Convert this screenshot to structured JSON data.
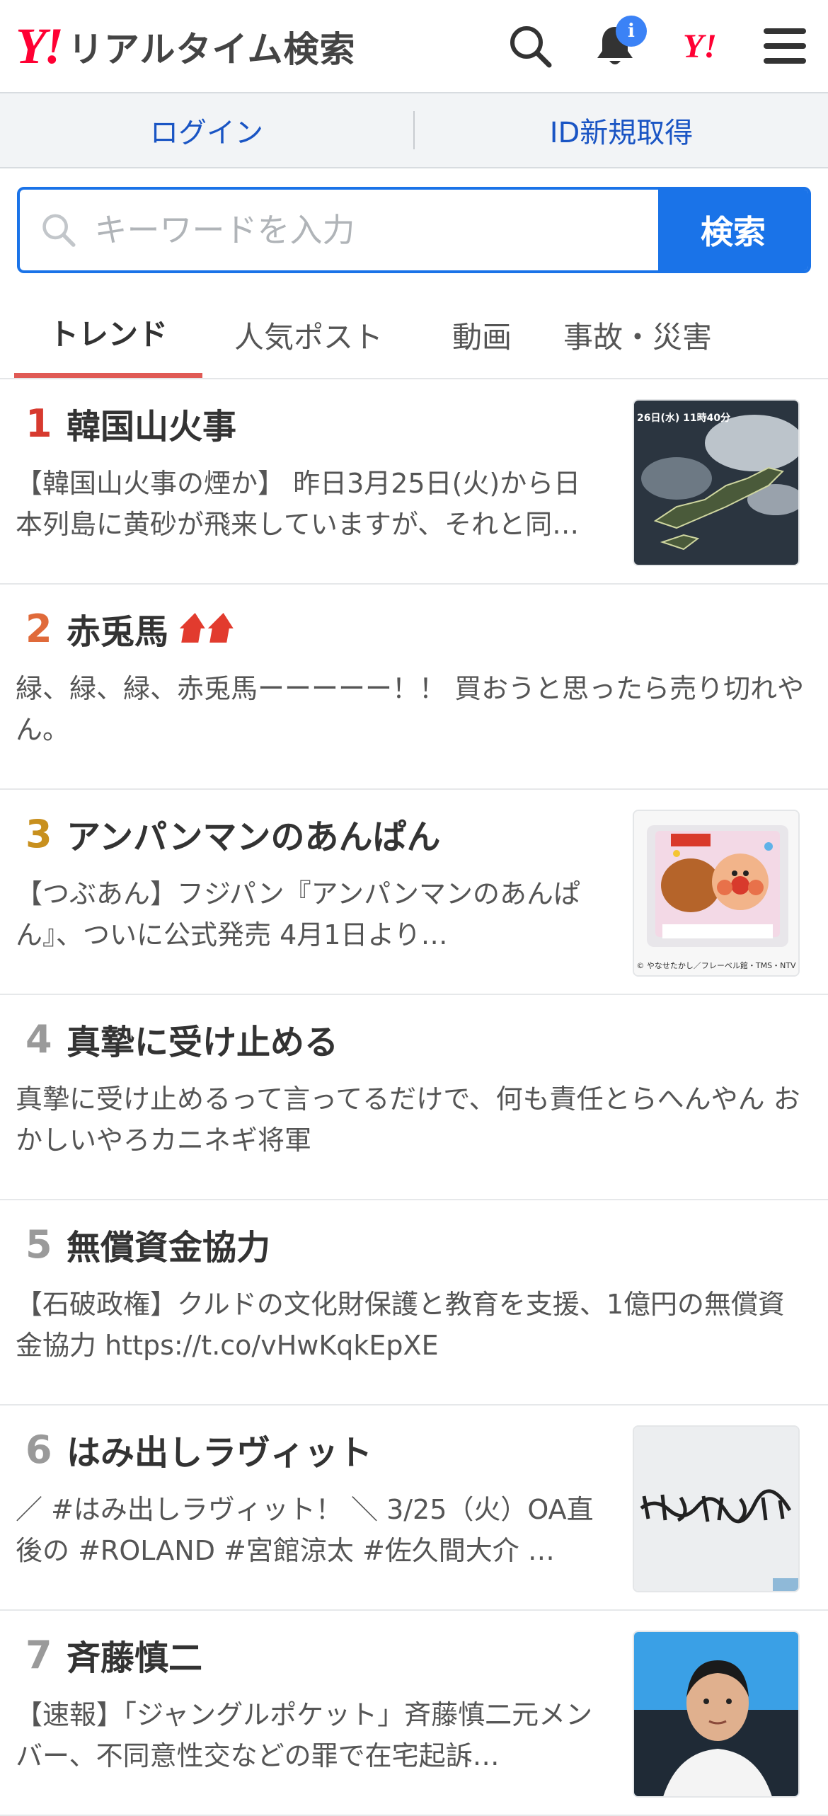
{
  "header": {
    "logo_mark": "Y!",
    "logo_text": "リアルタイム検索",
    "notification_badge": "i",
    "yahoo_small_logo": "Y!"
  },
  "account": {
    "login": "ログイン",
    "register": "ID新規取得"
  },
  "search": {
    "placeholder": "キーワードを入力",
    "button": "検索"
  },
  "tabs": [
    {
      "label": "トレンド",
      "active": true
    },
    {
      "label": "人気ポスト",
      "active": false
    },
    {
      "label": "動画",
      "active": false
    },
    {
      "label": "事故・災害",
      "active": false
    }
  ],
  "trends": [
    {
      "rank": "1",
      "rank_color": "#d73a2f",
      "title": "韓国山火事",
      "text": "【韓国山火事の煙か】 昨日3月25日(火)から日本列島に黄砂が飛来していますが、それと同…",
      "thumb_icon": "satellite-map-thumbnail",
      "thumb_caption": "26日(水) 11時40分"
    },
    {
      "rank": "2",
      "rank_color": "#e06a3a",
      "title": "赤兎馬",
      "text": "緑、緑、緑、赤兎馬ーーーーー！！ 買おうと思ったら売り切れやん。",
      "trend_icon": "double-up-arrow-icon"
    },
    {
      "rank": "3",
      "rank_color": "#c8901e",
      "title": "アンパンマンのあんぱん",
      "text": "【つぶあん】フジパン『アンパンマンのあんぱん』、ついに公式発売 4月1日より…",
      "thumb_icon": "anpan-package-thumbnail",
      "thumb_caption": "© やなせたかし／フレーベル館・TMS・NTV"
    },
    {
      "rank": "4",
      "rank_color": "#9a9a9a",
      "title": "真摯に受け止める",
      "text": "真摯に受け止めるって言ってるだけで、何も責任とらへんやん おかしいやろカニネギ将軍"
    },
    {
      "rank": "5",
      "rank_color": "#9a9a9a",
      "title": "無償資金協力",
      "text": "【石破政権】クルドの文化財保護と教育を支援、1億円の無償資金協力 https://t.co/vHwKqkEpXE"
    },
    {
      "rank": "6",
      "rank_color": "#9a9a9a",
      "title": "はみ出しラヴィット",
      "text": "／ #はみ出しラヴィット！ ＼ 3/25（火）OA直後の #ROLAND #宮館涼太 #佐久間大介 …",
      "thumb_icon": "handwritten-whiteboard-thumbnail"
    },
    {
      "rank": "7",
      "rank_color": "#9a9a9a",
      "title": "斉藤慎二",
      "text": "【速報】「ジャングルポケット」斉藤慎二元メンバー、不同意性交などの罪で在宅起訴…",
      "thumb_icon": "person-photo-thumbnail"
    }
  ],
  "colors": {
    "accent_blue": "#1a73e8",
    "link_blue": "#1a55c4",
    "yahoo_red": "#ff0033",
    "tab_underline": "#e05a55"
  }
}
